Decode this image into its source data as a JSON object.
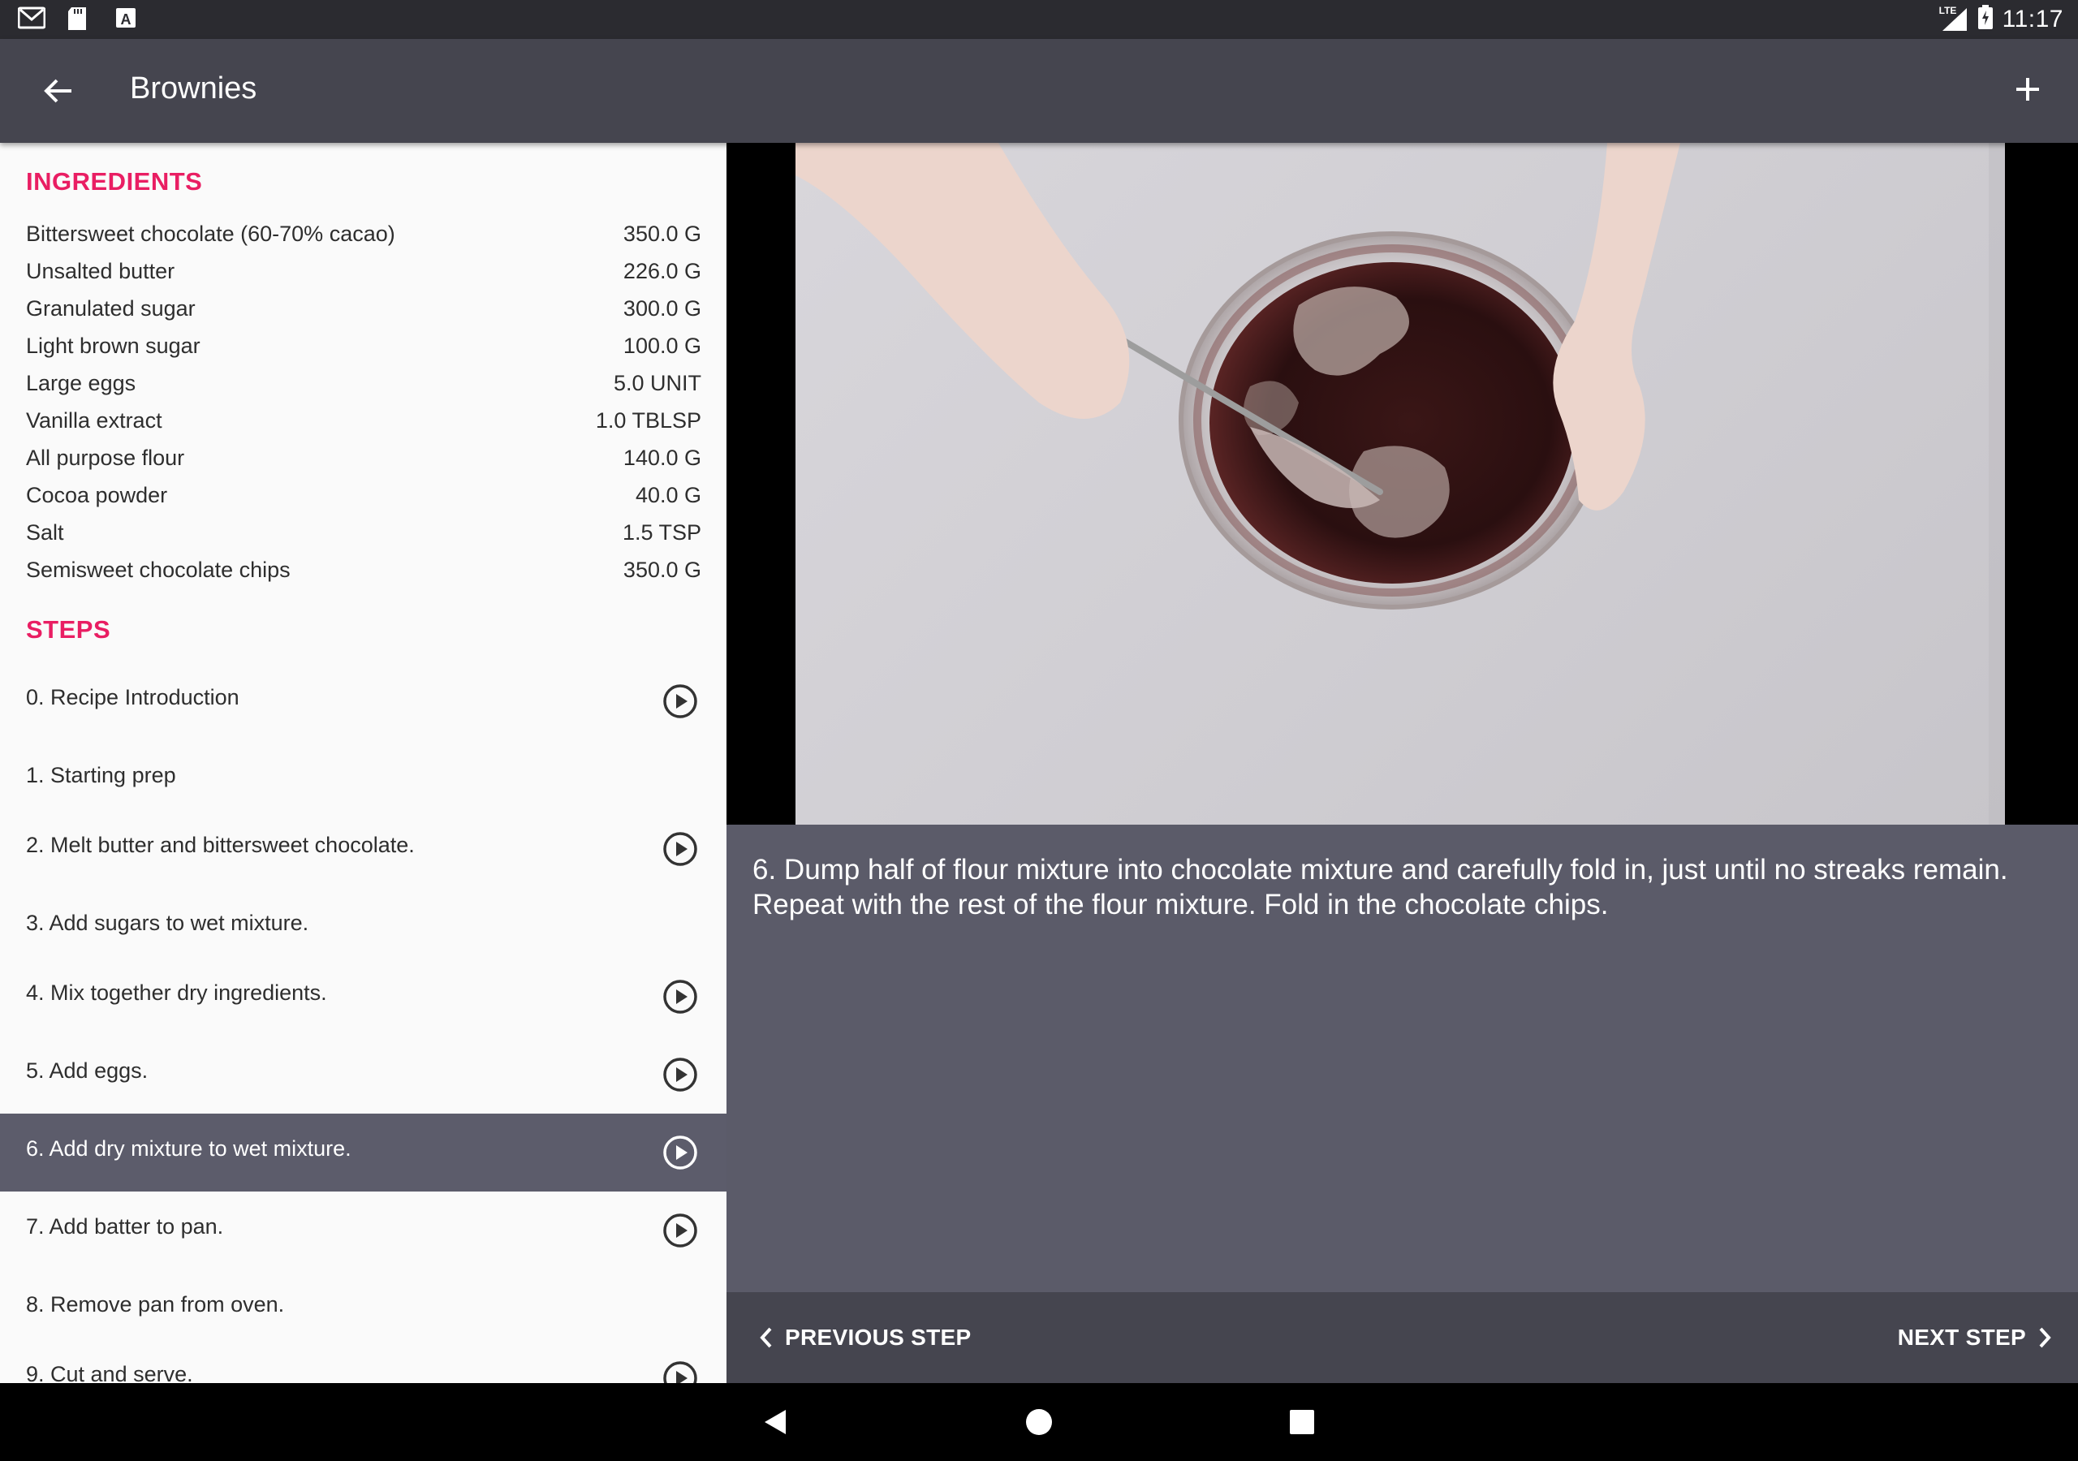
{
  "status_bar": {
    "time": "11:17",
    "left_icons": [
      "gmail-icon",
      "sd-card-icon",
      "a-notification-icon"
    ],
    "right_icons": [
      "lte-signal-icon",
      "battery-charging-icon"
    ],
    "network_label": "LTE"
  },
  "app_bar": {
    "title": "Brownies",
    "back_icon": "arrow-back-icon",
    "add_icon": "plus-icon"
  },
  "ingredients": {
    "heading": "INGREDIENTS",
    "items": [
      {
        "name": "Bittersweet chocolate (60-70% cacao)",
        "qty": "350.0 G"
      },
      {
        "name": "Unsalted butter",
        "qty": "226.0 G"
      },
      {
        "name": "Granulated sugar",
        "qty": "300.0 G"
      },
      {
        "name": "Light brown sugar",
        "qty": "100.0 G"
      },
      {
        "name": "Large eggs",
        "qty": "5.0 UNIT"
      },
      {
        "name": "Vanilla extract",
        "qty": "1.0 TBLSP"
      },
      {
        "name": "All purpose flour",
        "qty": "140.0 G"
      },
      {
        "name": "Cocoa powder",
        "qty": "40.0 G"
      },
      {
        "name": "Salt",
        "qty": "1.5 TSP"
      },
      {
        "name": "Semisweet chocolate chips",
        "qty": "350.0 G"
      }
    ]
  },
  "steps": {
    "heading": "STEPS",
    "items": [
      {
        "label": "0. Recipe Introduction",
        "has_video": true,
        "selected": false
      },
      {
        "label": "1. Starting prep",
        "has_video": false,
        "selected": false
      },
      {
        "label": "2. Melt butter and bittersweet chocolate.",
        "has_video": true,
        "selected": false
      },
      {
        "label": "3. Add sugars to wet mixture.",
        "has_video": false,
        "selected": false
      },
      {
        "label": "4. Mix together dry ingredients.",
        "has_video": true,
        "selected": false
      },
      {
        "label": "5. Add eggs.",
        "has_video": true,
        "selected": false
      },
      {
        "label": "6. Add dry mixture to wet mixture.",
        "has_video": true,
        "selected": true
      },
      {
        "label": "7. Add batter to pan.",
        "has_video": true,
        "selected": false
      },
      {
        "label": "8. Remove pan from oven.",
        "has_video": false,
        "selected": false
      },
      {
        "label": "9. Cut and serve.",
        "has_video": true,
        "selected": false
      }
    ]
  },
  "step_detail": {
    "description": "6. Dump half of flour mixture into chocolate mixture and carefully fold in, just until no streaks remain. Repeat with the rest of the flour mixture. Fold in the chocolate chips."
  },
  "navigation": {
    "previous_label": "PREVIOUS STEP",
    "next_label": "NEXT STEP"
  },
  "colors": {
    "accent": "#e91e63",
    "app_bar": "#45454f",
    "selected_row": "#5c5c6b",
    "detail_bg": "#5b5b69"
  }
}
